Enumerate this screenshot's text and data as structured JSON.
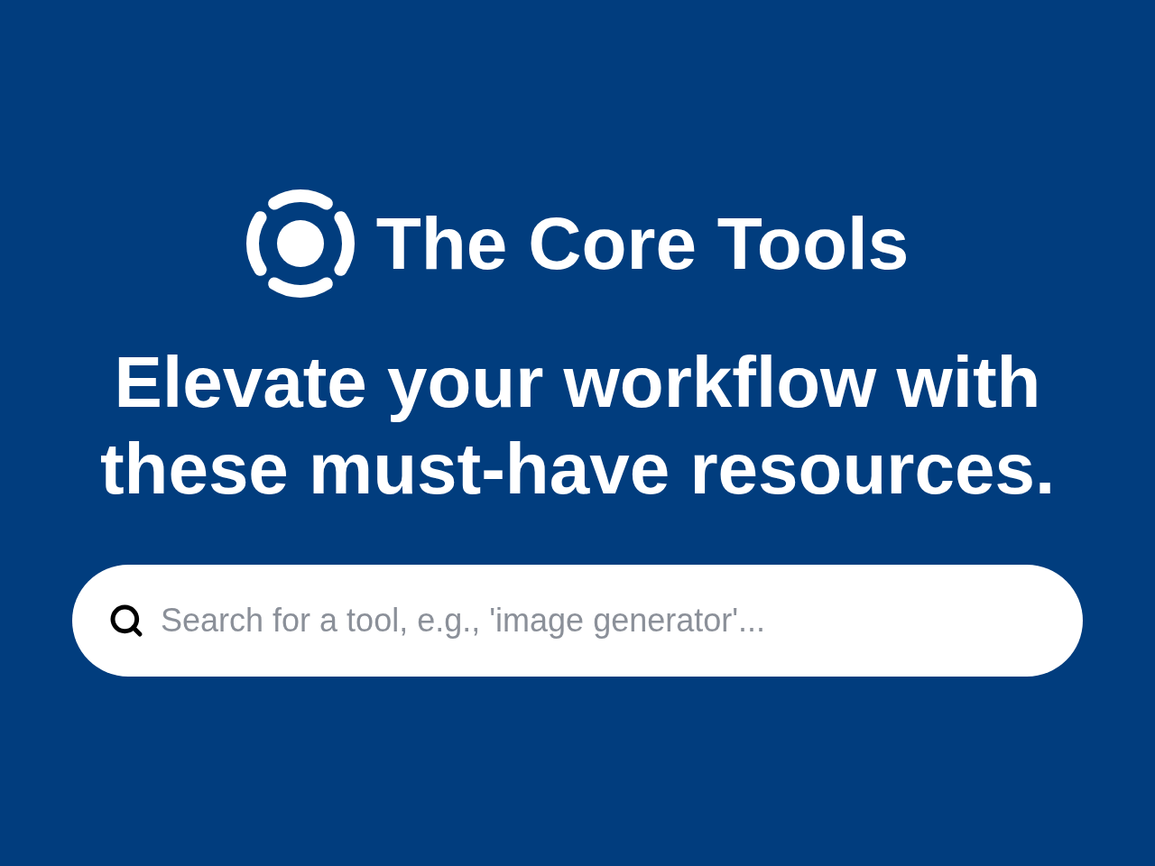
{
  "brand": {
    "name": "The Core Tools"
  },
  "headline": "Elevate your workflow with these must-have resources.",
  "search": {
    "placeholder": "Search for a tool, e.g., 'image generator'..."
  }
}
